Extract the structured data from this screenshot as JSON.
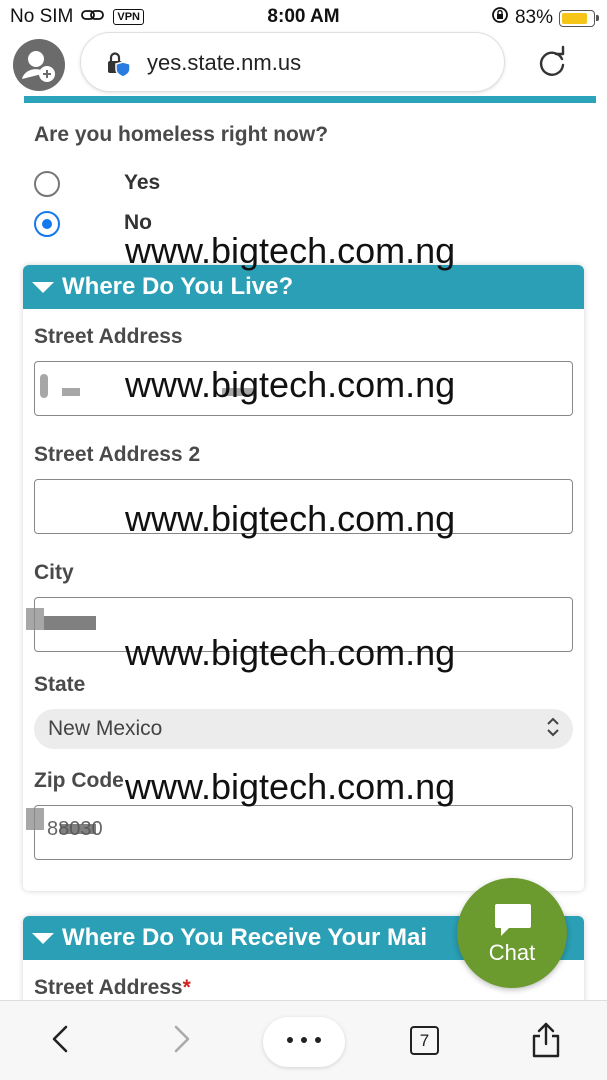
{
  "status_bar": {
    "carrier": "No SIM",
    "vpn": "VPN",
    "time": "8:00 AM",
    "battery": "83%",
    "battery_level": 0.83
  },
  "browser": {
    "url": "yes.state.nm.us"
  },
  "homeless": {
    "question": "Are you homeless right now?",
    "options": [
      "Yes",
      "No"
    ],
    "selected": "No"
  },
  "where_live": {
    "title": "Where Do You Live?",
    "street_address_label": "Street Address",
    "street_address_2_label": "Street Address 2",
    "city_label": "City",
    "state_label": "State",
    "state_value": "New Mexico",
    "zip_label": "Zip Code",
    "zip_value": "88030"
  },
  "mailing": {
    "title": "Where Do You Receive Your Mai",
    "street_address_label": "Street Address",
    "required_mark": "*"
  },
  "watermark": "www.bigtech.com.ng",
  "chat": {
    "label": "Chat"
  },
  "toolbar": {
    "tab_count": "7"
  },
  "colors": {
    "panel_header": "#2a9fb5",
    "radio_selected": "#1478f0",
    "chat_button": "#6b9a2e",
    "required": "#d02020"
  }
}
